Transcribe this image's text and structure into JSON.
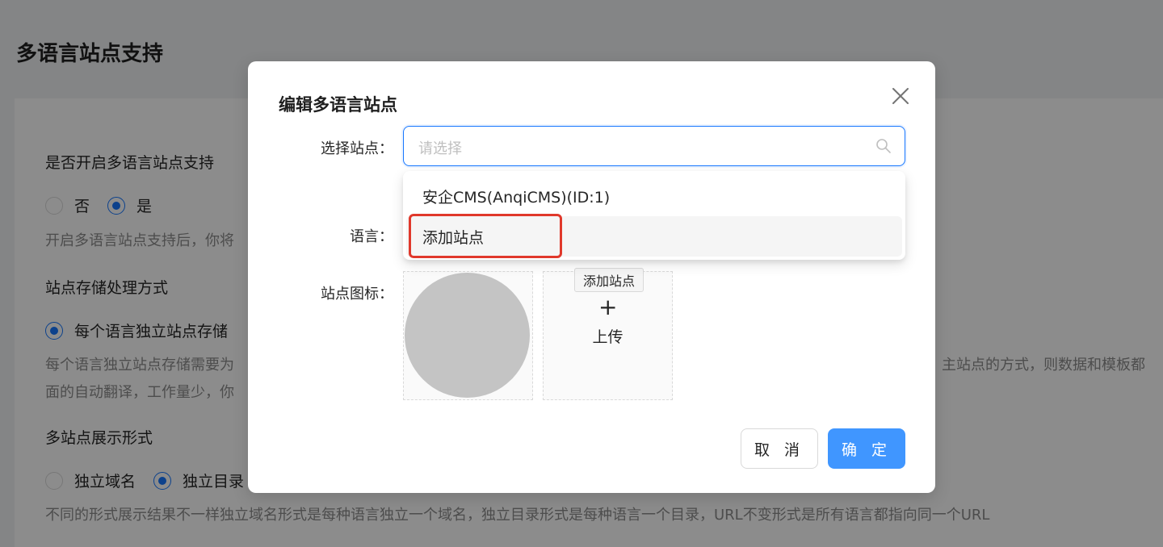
{
  "page": {
    "title": "多语言站点支持",
    "sections": {
      "enable_label": "是否开启多语言站点支持",
      "enable_options": [
        "否",
        "是"
      ],
      "enable_help": "开启多语言站点支持后，你将",
      "storage_label": "站点存储处理方式",
      "storage_option": "每个语言独立站点存储",
      "storage_help_line1_left": "每个语言独立站点存储需要为",
      "storage_help_line1_right": "主站点的方式，则数据和模板都",
      "storage_help_line2": "面的自动翻译，工作量少，你",
      "display_label": "多站点展示形式",
      "display_options": [
        "独立域名",
        "独立目录"
      ],
      "display_help": "不同的形式展示结果不一样独立域名形式是每种语言独立一个域名，独立目录形式是每种语言一个目录，URL不变形式是所有语言都指向同一个URL"
    }
  },
  "modal": {
    "title": "编辑多语言站点",
    "fields": {
      "site_label": "选择站点：",
      "site_placeholder": "请选择",
      "language_label": "语言：",
      "icon_label": "站点图标："
    },
    "dropdown": {
      "items": [
        "安企CMS(AnqiCMS)(ID:1)",
        "添加站点"
      ],
      "active_index": 1
    },
    "tooltip": "添加站点",
    "upload": {
      "plus": "+",
      "label": "上传"
    },
    "buttons": {
      "cancel": "取 消",
      "ok": "确 定"
    }
  },
  "colors": {
    "primary": "#1677ff",
    "button_primary": "#4096ff",
    "highlight": "#e0382b"
  },
  "icons": {
    "close": "close-icon",
    "search": "search-icon",
    "upload_plus": "plus-icon"
  }
}
